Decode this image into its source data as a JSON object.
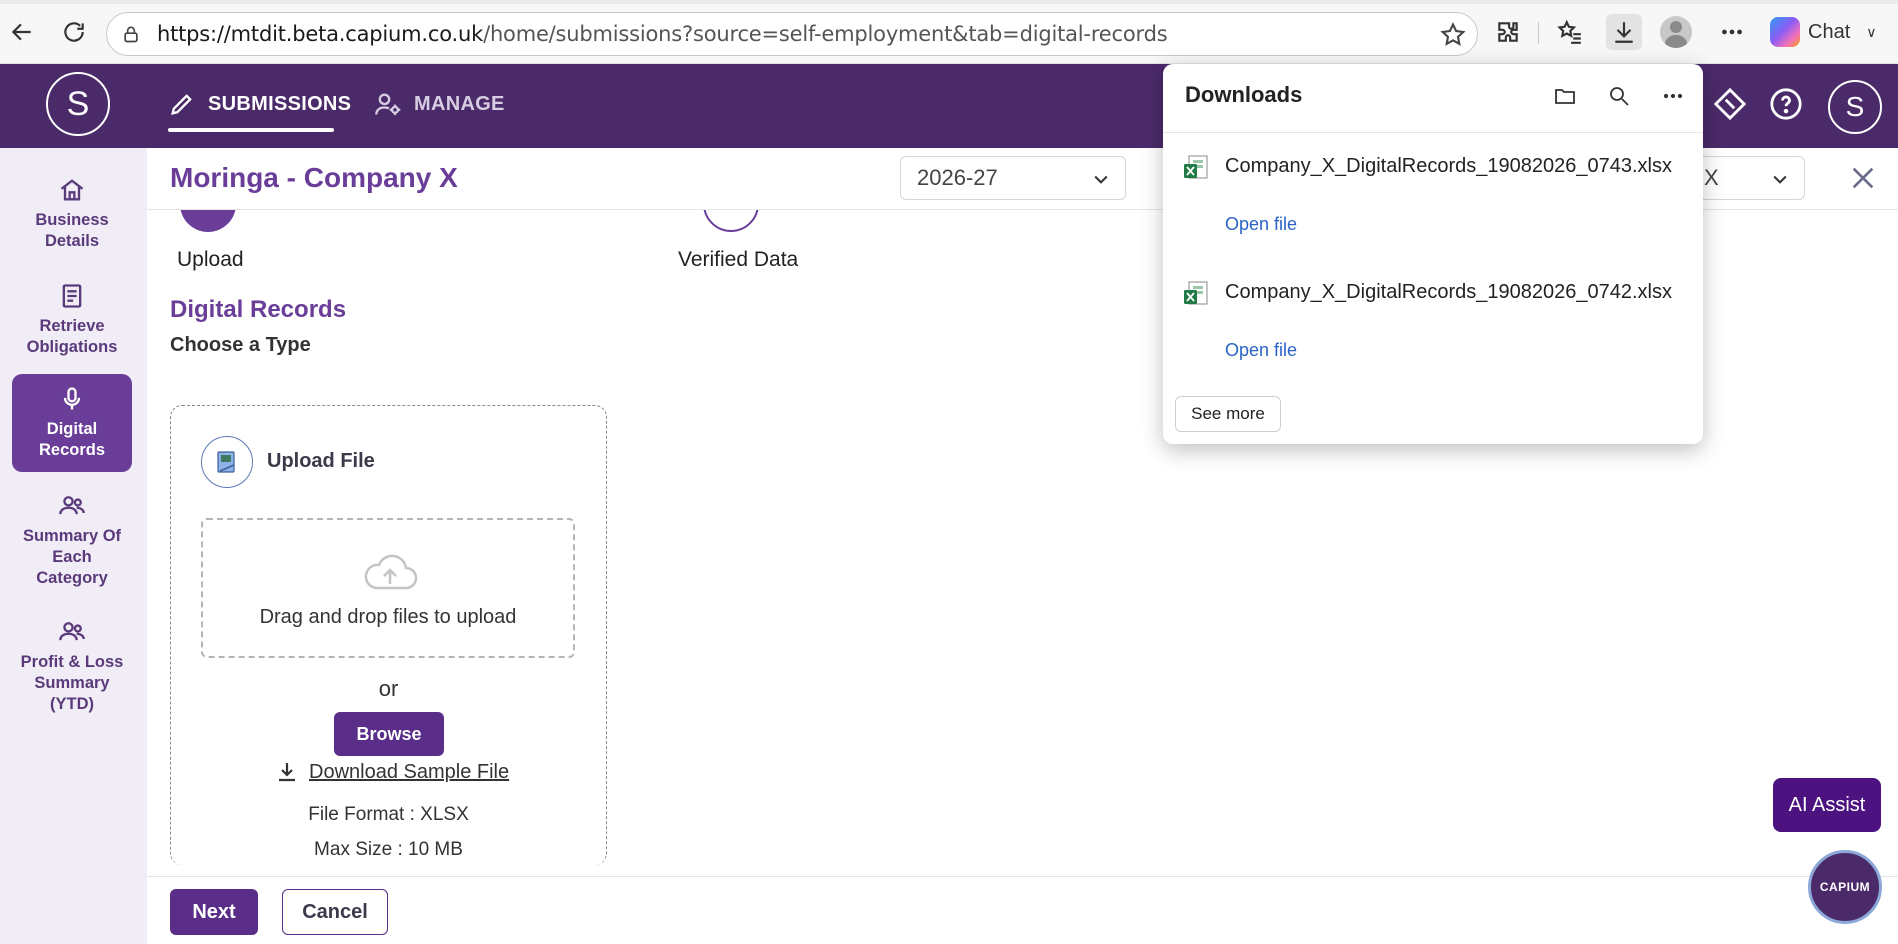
{
  "browser": {
    "url_host": "https://mtdit.beta.capium.co.uk",
    "url_path": "/home/submissions?source=self-employment&tab=digital-records",
    "chat_label": "Chat"
  },
  "header": {
    "logo_letter": "S",
    "tabs": [
      {
        "label": "SUBMISSIONS",
        "icon": "pencil-icon",
        "active": true
      },
      {
        "label": "MANAGE",
        "icon": "user-gear-icon",
        "active": false
      }
    ],
    "user_initial": "S"
  },
  "sidebar": {
    "items": [
      {
        "label": "Business Details",
        "icon": "home-icon",
        "active": false
      },
      {
        "label": "Retrieve Obligations",
        "icon": "document-icon",
        "active": false
      },
      {
        "label": "Digital Records",
        "icon": "microphone-icon",
        "active": true
      },
      {
        "label": "Summary Of Each Category",
        "icon": "users-icon",
        "active": false
      },
      {
        "label": "Profit & Loss Summary (YTD)",
        "icon": "users-icon",
        "active": false
      }
    ]
  },
  "page": {
    "title": "Moringa - Company X",
    "year": "2026-27",
    "second_select": "X"
  },
  "steps": [
    {
      "label": "Upload"
    },
    {
      "label": "Verified Data"
    }
  ],
  "section": {
    "title": "Digital Records",
    "subtitle": "Choose a Type"
  },
  "upload": {
    "title": "Upload File",
    "drop_text": "Drag and drop files to upload",
    "or_text": "or",
    "browse_label": "Browse",
    "sample_link": "Download Sample File",
    "file_format": "File Format : XLSX",
    "max_size": "Max Size : 10 MB"
  },
  "footer": {
    "next_label": "Next",
    "cancel_label": "Cancel"
  },
  "widgets": {
    "ai_assist": "AI Assist",
    "capium": "CAPIUM"
  },
  "downloads": {
    "title": "Downloads",
    "items": [
      {
        "name": "Company_X_DigitalRecords_19082026_0743.xlsx",
        "open": "Open file"
      },
      {
        "name": "Company_X_DigitalRecords_19082026_0742.xlsx",
        "open": "Open file"
      }
    ],
    "see_more": "See more"
  },
  "colors": {
    "brand_purple": "#4b2a6a",
    "accent_purple": "#6a3e98",
    "link_blue": "#2b63c6"
  }
}
